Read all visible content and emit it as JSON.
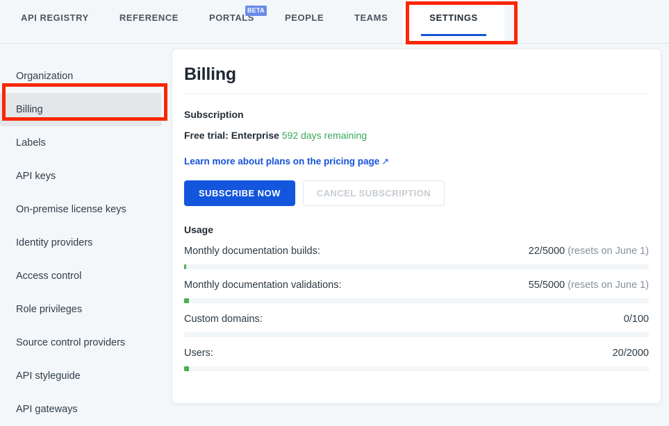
{
  "nav": {
    "tabs": [
      {
        "label": "API REGISTRY",
        "active": false,
        "badge": null
      },
      {
        "label": "REFERENCE",
        "active": false,
        "badge": null
      },
      {
        "label": "PORTALS",
        "active": false,
        "badge": "BETA"
      },
      {
        "label": "PEOPLE",
        "active": false,
        "badge": null
      },
      {
        "label": "TEAMS",
        "active": false,
        "badge": null
      },
      {
        "label": "SETTINGS",
        "active": true,
        "badge": null
      }
    ]
  },
  "sidebar": {
    "items": [
      {
        "label": "Organization",
        "active": false
      },
      {
        "label": "Billing",
        "active": true
      },
      {
        "label": "Labels",
        "active": false
      },
      {
        "label": "API keys",
        "active": false
      },
      {
        "label": "On-premise license keys",
        "active": false
      },
      {
        "label": "Identity providers",
        "active": false
      },
      {
        "label": "Access control",
        "active": false
      },
      {
        "label": "Role privileges",
        "active": false
      },
      {
        "label": "Source control providers",
        "active": false
      },
      {
        "label": "API styleguide",
        "active": false
      },
      {
        "label": "API gateways",
        "active": false
      }
    ]
  },
  "main": {
    "title": "Billing",
    "subscription": {
      "heading": "Subscription",
      "plan_prefix": "Free trial: Enterprise",
      "days_remaining": "592 days remaining",
      "pricing_link": "Learn more about plans on the pricing page",
      "pricing_link_arrow": "↗",
      "subscribe_button": "SUBSCRIBE NOW",
      "cancel_button": "CANCEL SUBSCRIPTION"
    },
    "usage": {
      "heading": "Usage",
      "rows": [
        {
          "label": "Monthly documentation builds:",
          "value": "22/5000",
          "resets": " (resets on June 1)",
          "percent": 0.44,
          "used": 22,
          "limit": 5000
        },
        {
          "label": "Monthly documentation validations:",
          "value": "55/5000",
          "resets": " (resets on June 1)",
          "percent": 1.1,
          "used": 55,
          "limit": 5000
        },
        {
          "label": "Custom domains:",
          "value": "0/100",
          "resets": "",
          "percent": 0,
          "used": 0,
          "limit": 100
        },
        {
          "label": "Users:",
          "value": "20/2000",
          "resets": "",
          "percent": 1.0,
          "used": 20,
          "limit": 2000
        }
      ]
    }
  },
  "annotations": [
    {
      "name": "settings-tab-highlight",
      "color": "#fa2600"
    },
    {
      "name": "billing-sidebar-highlight",
      "color": "#fa2600"
    }
  ],
  "colors": {
    "accent_blue": "#1355dd",
    "link_blue": "#1552d8",
    "success_green": "#3aa75b",
    "bar_green": "#4caf50",
    "beta_badge": "#6a8ce8",
    "page_bg": "#f4f7f9",
    "annotation_red": "#fa2600"
  }
}
